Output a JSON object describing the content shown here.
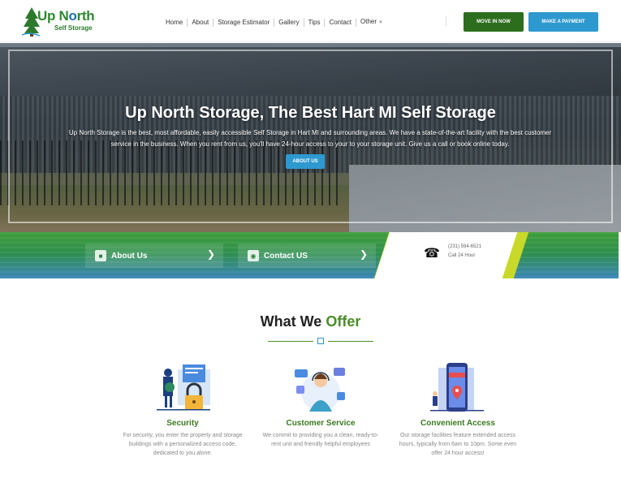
{
  "header": {
    "logo": {
      "title_up": "Up N",
      "title_rest": "rth",
      "subtitle": "Self Storage"
    },
    "nav": [
      {
        "label": "Home"
      },
      {
        "label": "About"
      },
      {
        "label": "Storage Estimator"
      },
      {
        "label": "Gallery"
      },
      {
        "label": "Tips"
      },
      {
        "label": "Contact"
      },
      {
        "label": "Other"
      }
    ],
    "move_in_label": "MOVE IN NOW",
    "payment_label": "MAKE A PAYMENT"
  },
  "hero": {
    "title": "Up North Storage, The Best Hart MI Self Storage",
    "description": "Up North Storage is the best, most affordable, easily accessible Self Storage in Hart MI and surrounding areas. We have a state-of-the-art facility with the best customer service in the business. When you rent from us, you'll have 24-hour access to your to your storage unit. Give us a call or book online today.",
    "button_label": "ABOUT US"
  },
  "quickbar": {
    "about_label": "About Us",
    "contact_label": "Contact US",
    "phone": "(231) 594-6521",
    "call_label": "Call 24 Hour"
  },
  "offer": {
    "title_main": "What We ",
    "title_accent": "Offer",
    "features": [
      {
        "title": "Security",
        "description": "For security, you enter the property and storage buildings with a personalized access code, dedicated to you alone."
      },
      {
        "title": "Customer Service",
        "description": "We commit to providing you a clean, ready-to-rent unit and friendly helpful employees"
      },
      {
        "title": "Convenient Access",
        "description": "Our storage facilities feature extended access hours, typically from 6am to 10pm. Some even offer 24 hour access!"
      }
    ]
  },
  "colors": {
    "brand_green": "#2d6e1e",
    "brand_blue": "#2e99cf",
    "accent_green": "#4b8c2a",
    "lime": "#c8d92a"
  }
}
